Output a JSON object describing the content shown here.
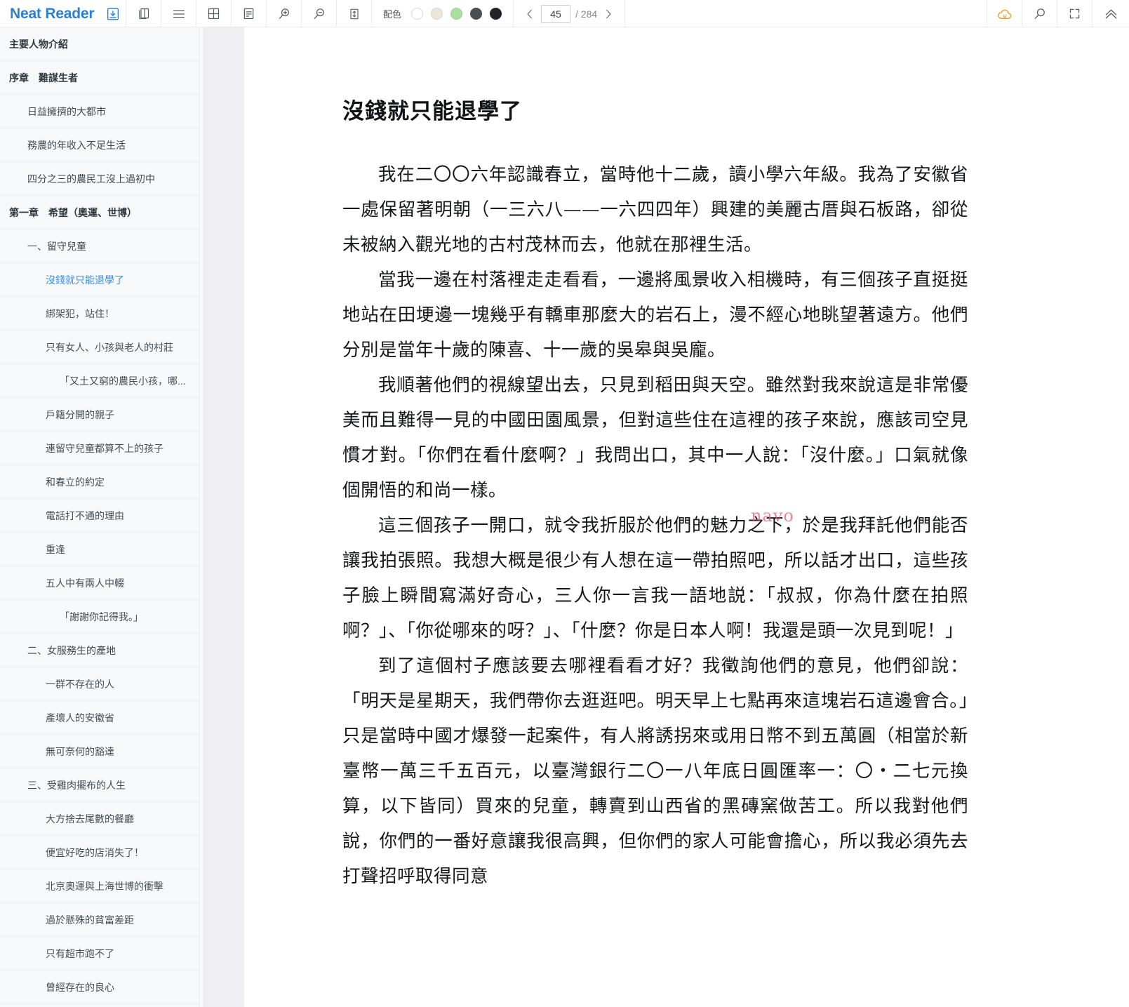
{
  "app": {
    "brand": "Neat Reader",
    "icons": {
      "save": "save-download-icon",
      "copy": "book-copy-icon",
      "menu": "hamburger-menu-icon",
      "grid": "grid-layout-icon",
      "reading": "reading-layout-icon",
      "zoom_in": "zoom-in-icon",
      "zoom_out": "zoom-out-icon",
      "line_height": "line-height-icon",
      "cloud": "cloud-sync-icon",
      "search": "search-icon",
      "fullscreen": "fullscreen-icon",
      "collapse": "chevron-up-double-icon",
      "prev_page": "chevron-left-icon",
      "next_page": "chevron-right-icon"
    }
  },
  "toolbar": {
    "palette_label": "配色",
    "swatches": [
      {
        "name": "white",
        "color": "#ffffff",
        "border": "#d8dade"
      },
      {
        "name": "sepia",
        "color": "#ebe6d8",
        "border": "#dcd6c6"
      },
      {
        "name": "green",
        "color": "#a9e0a0",
        "border": "#9ad290"
      },
      {
        "name": "dark-gray",
        "color": "#4a4d52",
        "border": "#4a4d52"
      },
      {
        "name": "black",
        "color": "#222428",
        "border": "#222428"
      }
    ],
    "page_current": "45",
    "page_total": "/ 284"
  },
  "accent": {
    "brand_blue": "#2b7fd4",
    "active_blue": "#3a8ee6",
    "orange": "#f0a030",
    "watermark_red": "#e05a6a"
  },
  "sidebar": {
    "items": [
      {
        "label": "主要人物介紹",
        "level": 0,
        "active": false
      },
      {
        "label": "序章　難謀生者",
        "level": 0,
        "active": false
      },
      {
        "label": "日益擁擠的大都市",
        "level": 1,
        "active": false
      },
      {
        "label": "務農的年收入不足生活",
        "level": 1,
        "active": false
      },
      {
        "label": "四分之三的農民工沒上過初中",
        "level": 1,
        "active": false
      },
      {
        "label": "第一章　希望（奧運、世博）",
        "level": 0,
        "active": false
      },
      {
        "label": "一、留守兒童",
        "level": 1,
        "active": false
      },
      {
        "label": "沒錢就只能退學了",
        "level": 2,
        "active": true
      },
      {
        "label": "綁架犯，站住！",
        "level": 2,
        "active": false
      },
      {
        "label": "只有女人、小孩與老人的村莊",
        "level": 2,
        "active": false
      },
      {
        "label": "「又土又窮的農民小孩，哪...",
        "level": 3,
        "active": false
      },
      {
        "label": "戶籍分開的親子",
        "level": 2,
        "active": false
      },
      {
        "label": "連留守兒童都算不上的孩子",
        "level": 2,
        "active": false
      },
      {
        "label": "和春立的約定",
        "level": 2,
        "active": false
      },
      {
        "label": "電話打不通的理由",
        "level": 2,
        "active": false
      },
      {
        "label": "重逢",
        "level": 2,
        "active": false
      },
      {
        "label": "五人中有兩人中輟",
        "level": 2,
        "active": false
      },
      {
        "label": "「謝謝你記得我。」",
        "level": 3,
        "active": false
      },
      {
        "label": "二、女服務生的產地",
        "level": 1,
        "active": false
      },
      {
        "label": "一群不存在的人",
        "level": 2,
        "active": false
      },
      {
        "label": "產壞人的安徽省",
        "level": 2,
        "active": false
      },
      {
        "label": "無可奈何的豁達",
        "level": 2,
        "active": false
      },
      {
        "label": "三、受雞肉擺布的人生",
        "level": 1,
        "active": false
      },
      {
        "label": "大方捨去尾數的餐廳",
        "level": 2,
        "active": false
      },
      {
        "label": "便宜好吃的店消失了！",
        "level": 2,
        "active": false
      },
      {
        "label": "北京奧運與上海世博的衝擊",
        "level": 2,
        "active": false
      },
      {
        "label": "過於懸殊的貧富差距",
        "level": 2,
        "active": false
      },
      {
        "label": "只有超市跑不了",
        "level": 2,
        "active": false
      },
      {
        "label": "曾經存在的良心",
        "level": 2,
        "active": false
      }
    ]
  },
  "content": {
    "title": "沒錢就只能退學了",
    "watermark": "navo",
    "paragraphs": [
      "我在二〇〇六年認識春立，當時他十二歲，讀小學六年級。我為了安徽省一處保留著明朝（一三六八——一六四四年）興建的美麗古厝與石板路，卻從未被納入觀光地的古村茂林而去，他就在那裡生活。",
      "當我一邊在村落裡走走看看，一邊將風景收入相機時，有三個孩子直挺挺地站在田埂邊一塊幾乎有轎車那麼大的岩石上，漫不經心地眺望著遠方。他們分別是當年十歲的陳喜、十一歲的吳皋與吳龐。",
      "我順著他們的視線望出去，只見到稻田與天空。雖然對我來說這是非常優美而且難得一見的中國田園風景，但對這些住在這裡的孩子來說，應該司空見慣才對。「你們在看什麼啊？」我問出口，其中一人說：「沒什麼。」口氣就像個開悟的和尚一樣。",
      "這三個孩子一開口，就令我折服於他們的魅力之下，於是我拜託他們能否讓我拍張照。我想大概是很少有人想在這一帶拍照吧，所以話才出口，這些孩子臉上瞬間寫滿好奇心，三人你一言我一語地説：「叔叔，你為什麼在拍照啊？」、「你從哪來的呀？」、「什麼？你是日本人啊！我還是頭一次見到呢！」",
      "到了這個村子應該要去哪裡看看才好？我徵詢他們的意見，他們卻說：「明天是星期天，我們帶你去逛逛吧。明天早上七點再來這塊岩石這邊會合。」只是當時中國才爆發一起案件，有人將誘拐來或用日幣不到五萬圓（相當於新臺幣一萬三千五百元，以臺灣銀行二〇一八年底日圓匯率一：〇・二七元換算，以下皆同）買來的兒童，轉賣到山西省的黑磚窯做苦工。所以我對他們說，你們的一番好意讓我很高興，但你們的家人可能會擔心，所以我必須先去打聲招呼取得同意"
    ]
  }
}
